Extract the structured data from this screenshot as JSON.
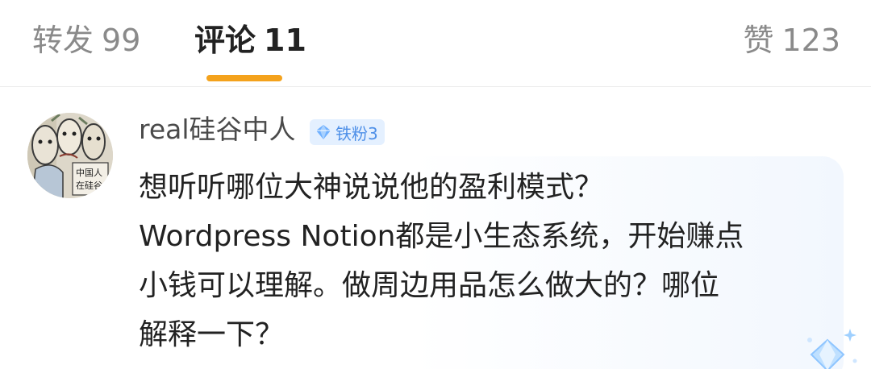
{
  "tabs": {
    "reposts": {
      "label": "转发",
      "count": "99"
    },
    "comments": {
      "label": "评论",
      "count": "11"
    },
    "likes": {
      "label": "赞",
      "count": "123"
    }
  },
  "comment": {
    "username": "real硅谷中人",
    "badge": {
      "icon": "diamond-icon",
      "label": "铁粉3"
    },
    "avatar_text": "中国人在硅谷",
    "text": "想听听哪位大神说说他的盈利模式？\nWordpress Notion都是小生态系统，开始赚点\n小钱可以理解。做周边用品怎么做大的？哪位\n解释一下？"
  },
  "colors": {
    "accent": "#f4a21c",
    "badge_bg": "#e4f0ff",
    "badge_text": "#4d8fe8",
    "inactive_tab": "#8a8a8a",
    "active_tab": "#222222"
  }
}
